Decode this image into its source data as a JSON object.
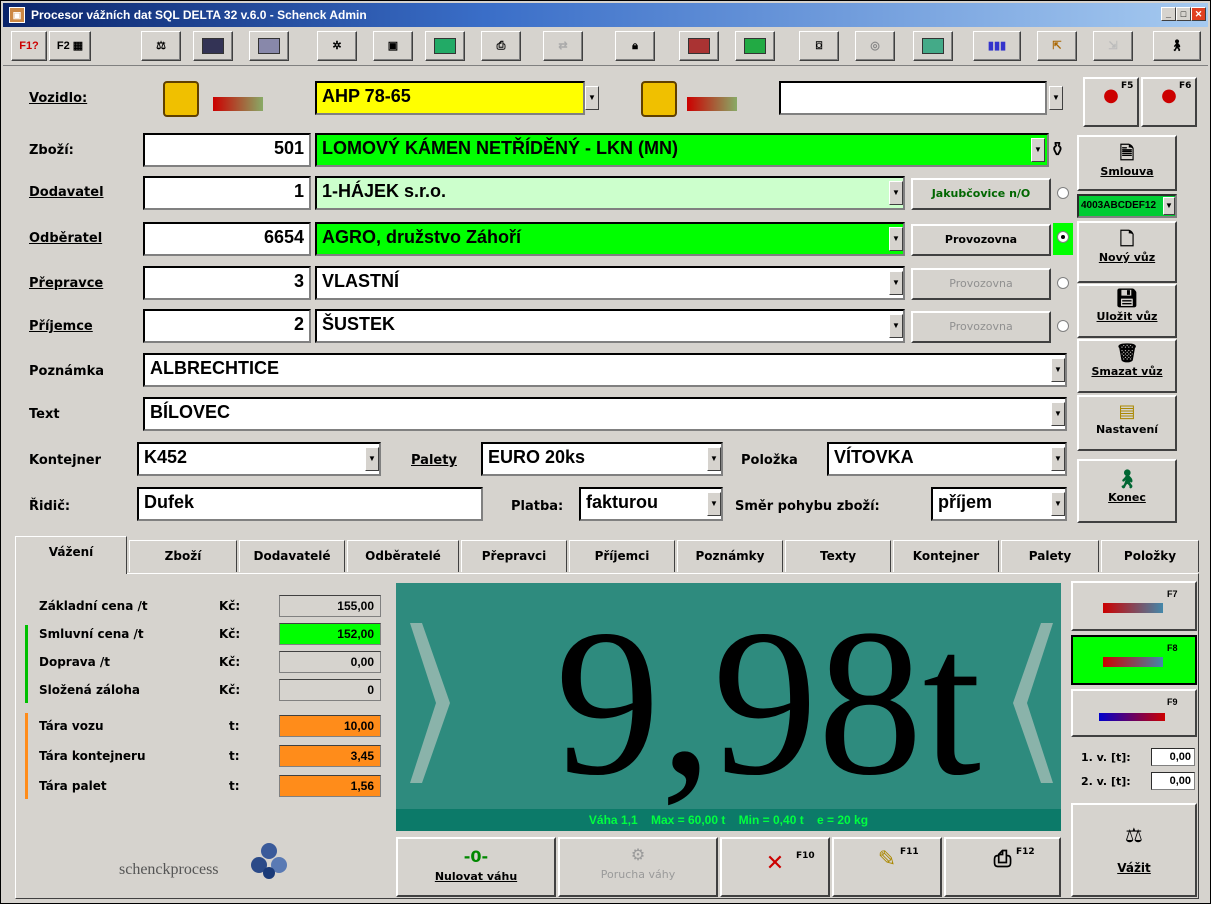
{
  "title_bar": {
    "title": "Procesor vážních dat SQL DELTA 32 v.6.0 - Schenck Admin",
    "icon": "app-icon"
  },
  "toolbar": {
    "f1_label": "F1?",
    "f2_label": "F2"
  },
  "vehicle": {
    "label": "Vozidlo:",
    "plate1": "AHP 78-65",
    "plate2": ""
  },
  "goods": {
    "label": "Zboží:",
    "code": "501",
    "name": "LOMOVÝ KÁMEN NETŘÍDĚNÝ - LKN (MN)"
  },
  "supplier": {
    "label": "Dodavatel",
    "code": "1",
    "name": "1-HÁJEK s.r.o.",
    "button": "Jakubčovice n/O"
  },
  "customer": {
    "label": "Odběratel",
    "code": "6654",
    "name": "AGRO, družstvo Záhoří",
    "button": "Provozovna"
  },
  "carrier": {
    "label": "Přepravce",
    "code": "3",
    "name": "VLASTNÍ",
    "button": "Provozovna"
  },
  "recipient": {
    "label": "Příjemce",
    "code": "2",
    "name": "ŠUSTEK",
    "button": "Provozovna"
  },
  "note": {
    "label": "Poznámka",
    "value": "ALBRECHTICE"
  },
  "text": {
    "label": "Text",
    "value": "BÍLOVEC"
  },
  "container": {
    "label": "Kontejner",
    "value": "K452"
  },
  "pallets": {
    "label": "Palety",
    "value": "EURO 20ks"
  },
  "item": {
    "label": "Položka",
    "value": "VÍTOVKA"
  },
  "driver": {
    "label": "Řidič:",
    "value": "Dufek"
  },
  "payment": {
    "label": "Platba:",
    "value": "fakturou"
  },
  "direction": {
    "label": "Směr pohybu zboží:",
    "value": "příjem"
  },
  "right_panel": {
    "contract": "Smlouva",
    "contract_code": "4003ABCDEF12",
    "new": "Nový vůz",
    "save": "Uložit vůz",
    "delete": "Smazat vůz",
    "settings": "Nastavení",
    "exit": "Konec"
  },
  "tabs": [
    "Vážení",
    "Zboží",
    "Dodavatelé",
    "Odběratelé",
    "Přepravci",
    "Příjemci",
    "Poznámky",
    "Texty",
    "Kontejner",
    "Palety",
    "Položky"
  ],
  "prices": [
    {
      "label": "Základní cena /t",
      "unit": "Kč:",
      "value": "155,00"
    },
    {
      "label": "Smluvní cena /t",
      "unit": "Kč:",
      "value": "152,00"
    },
    {
      "label": "Doprava /t",
      "unit": "Kč:",
      "value": "0,00"
    },
    {
      "label": "Složená záloha",
      "unit": "Kč:",
      "value": "0"
    },
    {
      "label": "Tára vozu",
      "unit": "t:",
      "value": "10,00"
    },
    {
      "label": "Tára kontejneru",
      "unit": "t:",
      "value": "3,45"
    },
    {
      "label": "Tára palet",
      "unit": "t:",
      "value": "1,56"
    }
  ],
  "display": {
    "weight": "9,98t",
    "info": "Váha 1,1    Max = 60,00 t    Min = 0,40 t    e = 20 kg"
  },
  "bottom_buttons": {
    "zero_symbol": "-0-",
    "zero_label": "Nulovat váhu",
    "fault_label": "Porucha váhy",
    "f10": "F10",
    "f11": "F11",
    "f12": "F12",
    "weigh": "Vážit"
  },
  "side": {
    "f7": "F7",
    "f8": "F8",
    "f9": "F9",
    "v1_label": "1. v. [t]:",
    "v1_value": "0,00",
    "v2_label": "2. v. [t]:",
    "v2_value": "0,00"
  },
  "traffic": {
    "f5": "F5",
    "f6": "F6"
  },
  "logo": "schenckprocess",
  "colors": {
    "yellow": "#ffff00",
    "green": "#00ff00",
    "light_green": "#ccffcc",
    "orange": "#ff8c1a",
    "display": "#2e8b7e"
  }
}
